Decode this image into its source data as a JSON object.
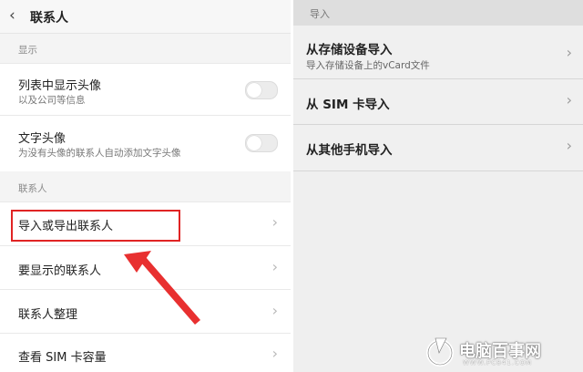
{
  "left": {
    "back_icon": "chevron-left-icon",
    "title": "联系人",
    "display_section": "显示",
    "show_avatar_title": "列表中显示头像",
    "show_avatar_sub": "以及公司等信息",
    "text_avatar_title": "文字头像",
    "text_avatar_sub": "为没有头像的联系人自动添加文字头像",
    "contacts_section": "联系人",
    "import_export": "导入或导出联系人",
    "contacts_to_display": "要显示的联系人",
    "organize_contacts": "联系人整理",
    "sim_capacity": "查看 SIM 卡容量",
    "toggles": {
      "show_avatar": false,
      "text_avatar": false
    }
  },
  "right": {
    "section": "导入",
    "from_storage_title": "从存储设备导入",
    "from_storage_sub": "导入存储设备上的vCard文件",
    "from_sim": "从 SIM 卡导入",
    "from_other_phone": "从其他手机导入"
  },
  "annotation": {
    "highlight_color": "#e02424",
    "arrow_color": "#e83030"
  },
  "watermark": {
    "name": "电脑百事网",
    "url": "WWW.PC841.COM"
  },
  "chevron_glyph": "›"
}
